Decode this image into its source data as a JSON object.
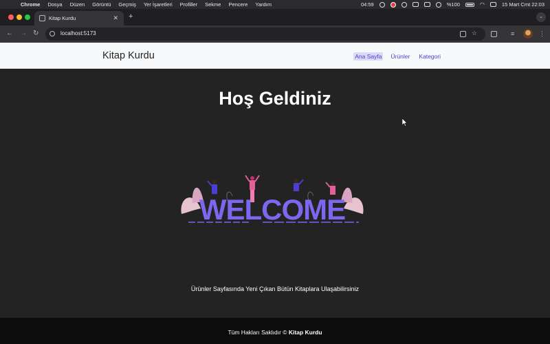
{
  "menubar": {
    "app": "Chrome",
    "menus": [
      "Dosya",
      "Düzen",
      "Görüntü",
      "Geçmiş",
      "Yer İşaretleri",
      "Profiller",
      "Sekme",
      "Pencere",
      "Yardım"
    ],
    "time_left": "04:59",
    "battery": "%100",
    "datetime": "15 Mart Cmt  22:03"
  },
  "browser": {
    "tab_title": "Kitap Kurdu",
    "url": "localhost:5173"
  },
  "site": {
    "brand": "Kitap Kurdu",
    "nav": [
      "Ana Sayfa",
      "Ürünler",
      "Kategori"
    ],
    "heading": "Hoş Geldiniz",
    "banner_text": "WELCOME",
    "subtitle": "Ürünler Sayfasında Yeni Çıkan Bütün Kitaplara Ulaşabilirsiniz",
    "footer_prefix": "Tüm Hakları Saklıdır ©",
    "footer_brand": "Kitap Kurdu"
  },
  "colors": {
    "nav_link": "#4b3fd1",
    "nav_active_bg": "#dcdaf7",
    "page_bg": "#232323",
    "footer_bg": "#0c0c0c",
    "welcome_letters": "#7b68ee"
  }
}
